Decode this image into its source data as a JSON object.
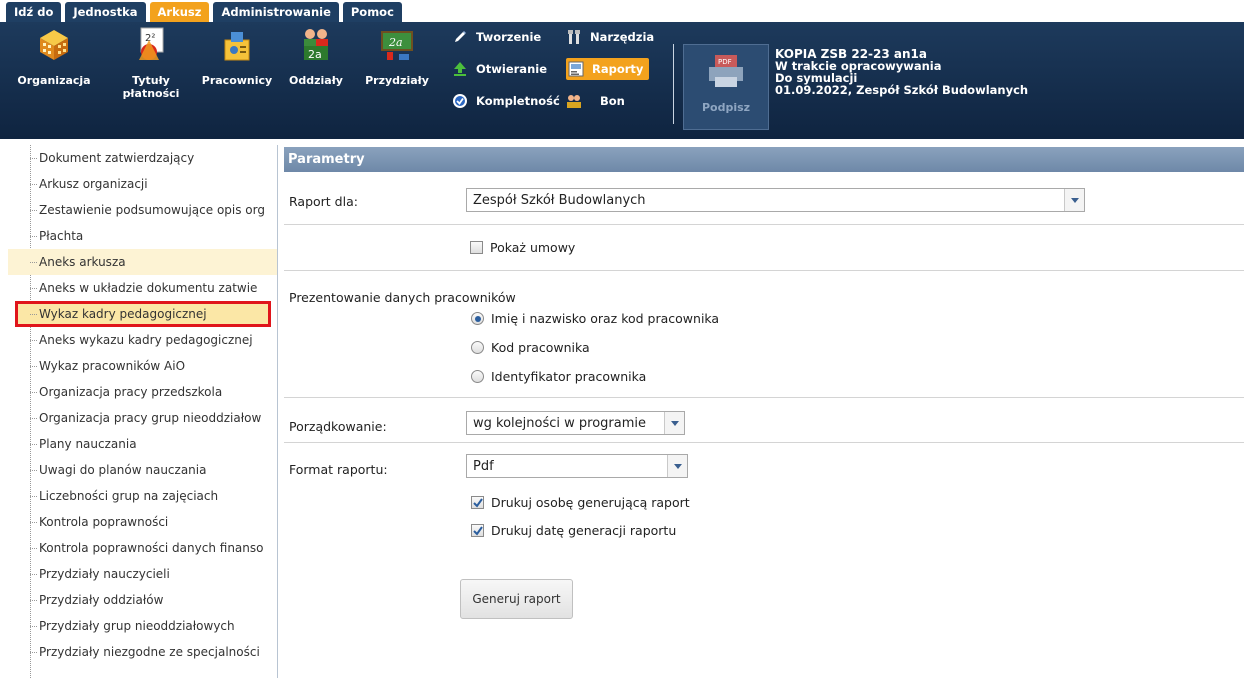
{
  "menu": {
    "tabs": [
      {
        "label": "Idź do",
        "active": false
      },
      {
        "label": "Jednostka",
        "active": false
      },
      {
        "label": "Arkusz",
        "active": true
      },
      {
        "label": "Administrowanie",
        "active": false
      },
      {
        "label": "Pomoc",
        "active": false
      }
    ]
  },
  "ribbon": {
    "organizacja": "Organizacja",
    "tytuly": "Tytuły\npłatności",
    "pracownicy": "Pracownicy",
    "oddzialy": "Oddziały",
    "przydzialy": "Przydziały",
    "tworzenie": "Tworzenie",
    "otwieranie": "Otwieranie",
    "kompletnosc": "Kompletność",
    "narzedzia": "Narzędzia",
    "raporty": "Raporty",
    "bon": "Bon",
    "podpisz": "Podpisz",
    "pdf_tag": "PDF",
    "icon_2a": "2a",
    "icon_2a_alt": "2a",
    "icon_2sq": "2²"
  },
  "document": {
    "line1": "KOPIA ZSB 22-23 an1a",
    "line2": "W trakcie opracowywania",
    "line3": "Do symulacji",
    "line4": "01.09.2022, Zespół Szkół Budowlanych"
  },
  "tree": {
    "items": [
      "Dokument zatwierdzający",
      "Arkusz organizacji",
      "Zestawienie podsumowujące opis org",
      "Płachta",
      "Aneks arkusza",
      "Aneks w układzie dokumentu zatwie",
      "Wykaz kadry pedagogicznej",
      "Aneks wykazu kadry pedagogicznej",
      "Wykaz pracowników AiO",
      "Organizacja pracy przedszkola",
      "Organizacja pracy grup nieoddziałow",
      "Plany nauczania",
      "Uwagi do planów nauczania",
      "Liczebności grup na zajęciach",
      "Kontrola poprawności",
      "Kontrola poprawności danych finanso",
      "Przydziały nauczycieli",
      "Przydziały oddziałów",
      "Przydziały grup nieoddziałowych",
      "Przydziały niezgodne ze specjalności"
    ],
    "hover_index": 4,
    "selected_index": 6
  },
  "params": {
    "header": "Parametry",
    "raport_dla_label": "Raport dla:",
    "raport_dla_value": "Zespół Szkół Budowlanych",
    "pokaz_umowy": "Pokaż umowy",
    "prezentowanie_label": "Prezentowanie danych pracowników",
    "radio_options": [
      {
        "label": "Imię i nazwisko oraz kod pracownika",
        "checked": true
      },
      {
        "label": "Kod pracownika",
        "checked": false
      },
      {
        "label": "Identyfikator pracownika",
        "checked": false
      }
    ],
    "porzadkowanie_label": "Porządkowanie:",
    "porzadkowanie_value": "wg kolejności w programie",
    "format_label": "Format raportu:",
    "format_value": "Pdf",
    "drukuj_osobe": "Drukuj osobę generującą raport",
    "drukuj_date": "Drukuj datę generacji raportu",
    "generuj": "Generuj raport"
  },
  "colors": {
    "ribbon_bg": "#1d3a5c",
    "active_tab": "#f3a21d",
    "selected_outline": "#e0151b",
    "selected_bg": "#fbe7a6",
    "panel_header": "#7b93b1"
  }
}
